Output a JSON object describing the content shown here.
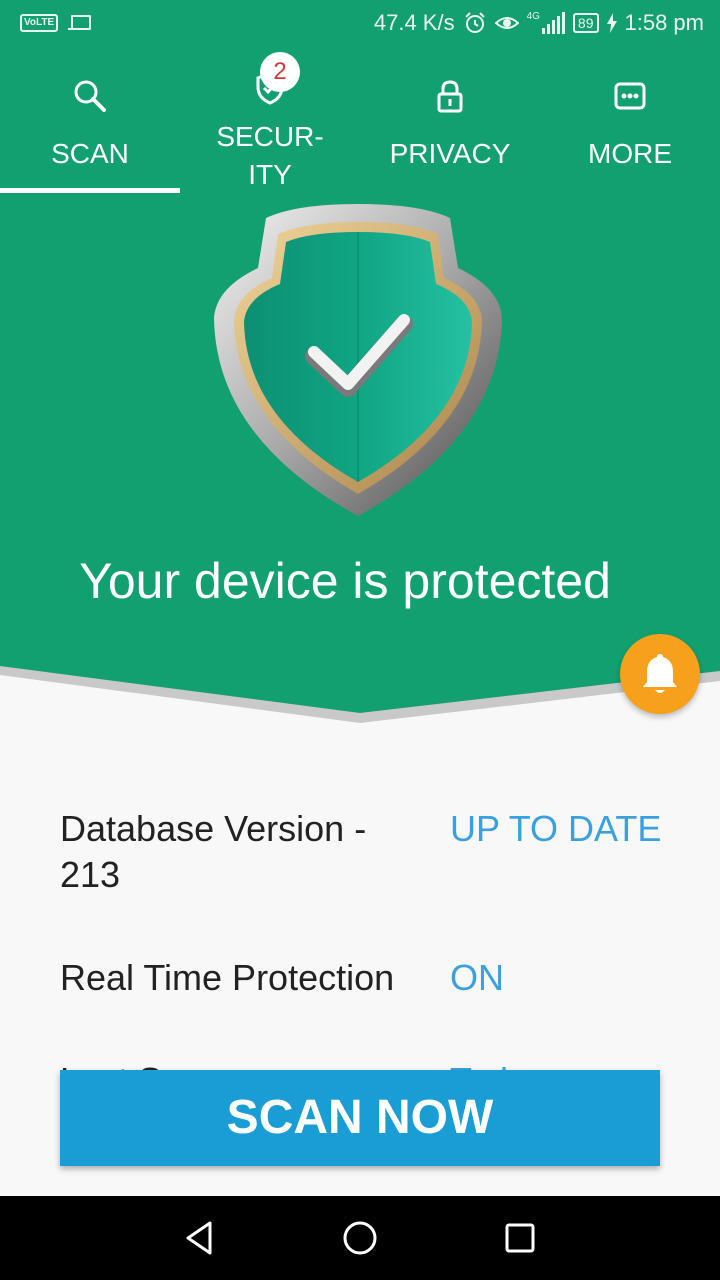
{
  "status_bar": {
    "left_indicator": "VoLTE",
    "network_speed": "47.4 K/s",
    "signal_type": "4G",
    "battery": "89",
    "time": "1:58 pm",
    "icons": [
      "volte-icon",
      "laptop-icon",
      "alarm-icon",
      "eye-icon",
      "signal-icon",
      "battery-icon",
      "charging-icon"
    ]
  },
  "tabs": [
    {
      "label": "SCAN",
      "icon": "search-icon",
      "selected": true
    },
    {
      "label": "SECUR-",
      "label_line2": "ITY",
      "icon": "shield-check-icon",
      "badge": "2"
    },
    {
      "label": "PRIVACY",
      "icon": "lock-icon"
    },
    {
      "label": "MORE",
      "icon": "more-icon"
    }
  ],
  "hero": {
    "status_title": "Your device is protected",
    "shield_icon": "shield-check-icon",
    "notification_icon": "bell-icon"
  },
  "info": [
    {
      "label": "Database Version - 213",
      "value": "UP TO DATE"
    },
    {
      "label": "Real Time Protection",
      "value": "ON"
    },
    {
      "label": "Last Scan",
      "value": "Today"
    }
  ],
  "scan_button": {
    "label": "SCAN NOW"
  },
  "colors": {
    "primary_green": "#13a070",
    "accent_blue": "#3ba0de",
    "button_blue": "#1a9cd5",
    "bell_orange": "#f7a01b",
    "badge_red": "#d23a3a"
  }
}
